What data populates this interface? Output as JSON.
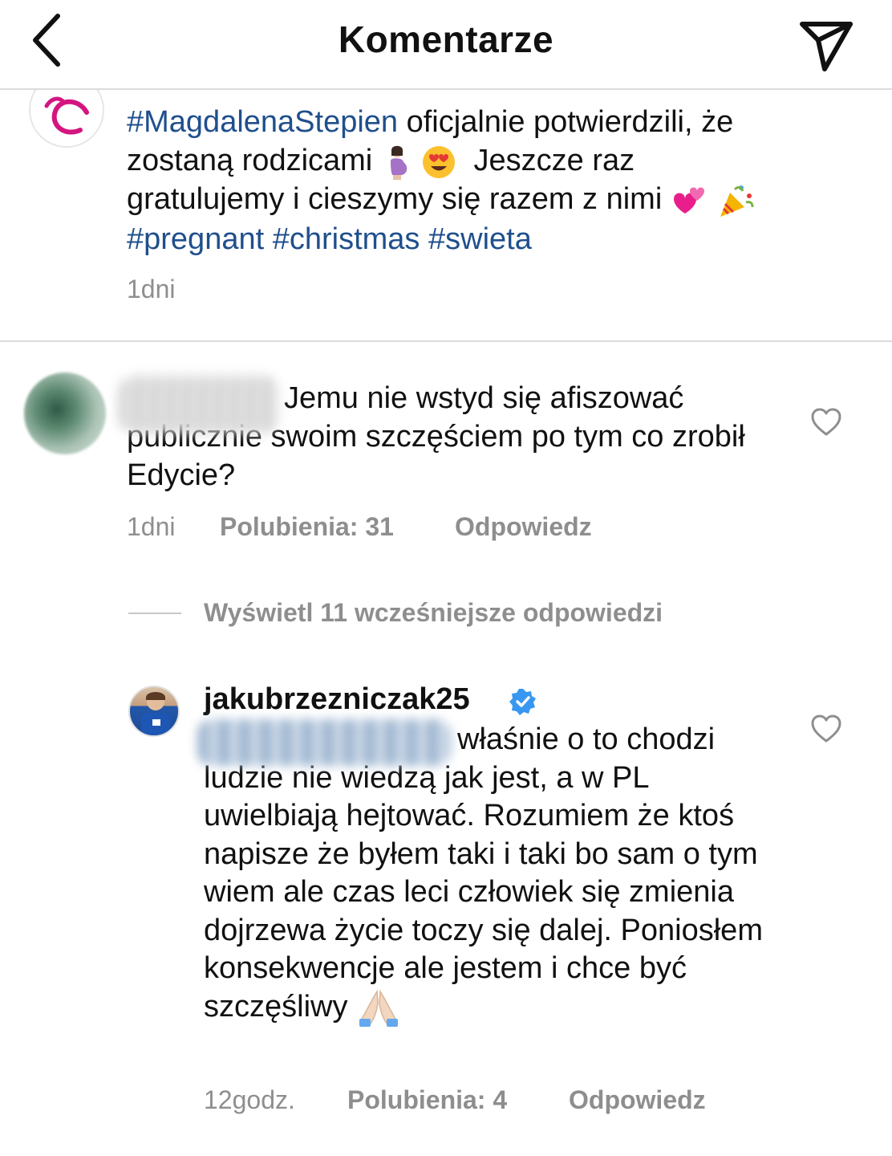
{
  "header": {
    "title": "Komentarze"
  },
  "caption": {
    "hashtag_name": "#MagdalenaStepien",
    "line1_rest": " oficjalnie potwierdzili, że",
    "line2": "zostaną rodzicami",
    "line2_after": "Jeszcze raz",
    "line3": "gratulujemy i cieszymy się razem z nimi",
    "tag1": "#pregnant",
    "tag2": "#christmas",
    "tag3": "#swieta",
    "time": "1dni"
  },
  "comment1": {
    "text": "Jemu nie wstyd się afiszować publicznie swoim szczęściem po tym co zrobił Edycie?",
    "time": "1dni",
    "likes": "Polubienia: 31",
    "reply": "Odpowiedz"
  },
  "view_more": "Wyświetl 11 wcześniejsze odpowiedzi",
  "reply1": {
    "username": "jakubrzezniczak25",
    "text": "właśnie o to chodzi ludzie nie wiedzą jak jest, a w PL uwielbiają hejtować. Rozumiem że ktoś napisze że byłem taki i taki bo sam o tym wiem ale czas leci człowiek się zmienia dojrzewa życie toczy się dalej. Poniosłem konsekwencje ale jestem i chce być szczęśliwy",
    "time": "12godz.",
    "likes": "Polubienia: 4",
    "reply": "Odpowiedz"
  },
  "icons": {
    "back": "chevron-left-icon",
    "share": "paper-plane-icon",
    "like": "heart-outline-icon",
    "verified": "verified-badge-icon",
    "emoji_pregnant": "pregnant-woman-emoji",
    "emoji_love": "heart-eyes-emoji",
    "emoji_hearts": "revolving-hearts-emoji",
    "emoji_party": "party-popper-emoji",
    "emoji_pray": "folded-hands-emoji"
  },
  "colors": {
    "hashtag": "#1f4f8c",
    "muted": "#8e8e8e",
    "verified": "#3897f0",
    "brand_pink": "#d4157f"
  }
}
